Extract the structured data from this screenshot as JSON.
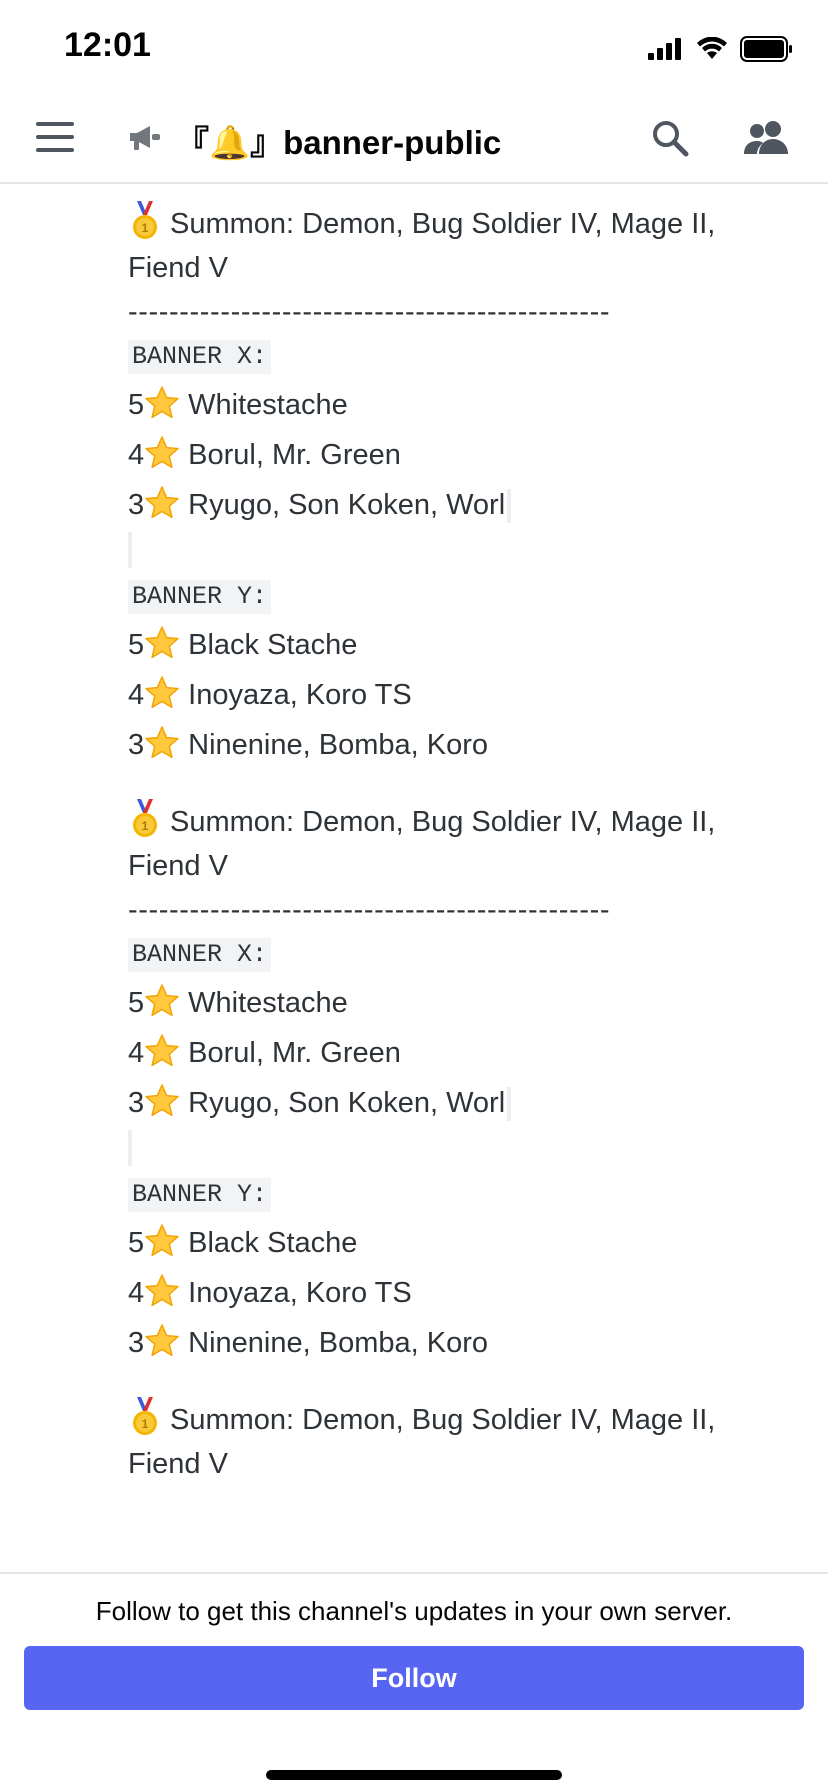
{
  "status_bar": {
    "time": "12:01"
  },
  "header": {
    "channel_prefix": "『🔔』",
    "channel_name": "banner-public"
  },
  "messages": [
    {
      "summon": "Summon: Demon, Bug Soldier IV, Mage II,",
      "summon_cont": "Fiend V",
      "separator": "-----------------------------------------------",
      "banners": [
        {
          "label": "BANNER X:",
          "rows": [
            {
              "rank": "5",
              "text": "Whitestache"
            },
            {
              "rank": "4",
              "text": "Borul, Mr. Green"
            },
            {
              "rank": "3",
              "text": "Ryugo, Son Koken, Worl"
            }
          ]
        },
        {
          "label": "BANNER Y:",
          "rows": [
            {
              "rank": "5",
              "text": "Black Stache"
            },
            {
              "rank": "4",
              "text": "Inoyaza, Koro TS"
            },
            {
              "rank": "3",
              "text": "Ninenine, Bomba, Koro"
            }
          ]
        }
      ]
    },
    {
      "summon": "Summon: Demon, Bug Soldier IV, Mage II,",
      "summon_cont": "Fiend V",
      "separator": "-----------------------------------------------",
      "banners": [
        {
          "label": "BANNER X:",
          "rows": [
            {
              "rank": "5",
              "text": "Whitestache"
            },
            {
              "rank": "4",
              "text": "Borul, Mr. Green"
            },
            {
              "rank": "3",
              "text": "Ryugo, Son Koken, Worl"
            }
          ]
        },
        {
          "label": "BANNER Y:",
          "rows": [
            {
              "rank": "5",
              "text": "Black Stache"
            },
            {
              "rank": "4",
              "text": "Inoyaza, Koro TS"
            },
            {
              "rank": "3",
              "text": "Ninenine, Bomba, Koro"
            }
          ]
        }
      ]
    },
    {
      "summon": "Summon: Demon, Bug Soldier IV, Mage II,",
      "summon_cont": "Fiend V"
    }
  ],
  "footer": {
    "follow_prompt": "Follow to get this channel's updates in your own server.",
    "follow_label": "Follow"
  },
  "colors": {
    "accent": "#5865f2",
    "text": "#2e3338",
    "code_bg": "#f2f3f5"
  }
}
